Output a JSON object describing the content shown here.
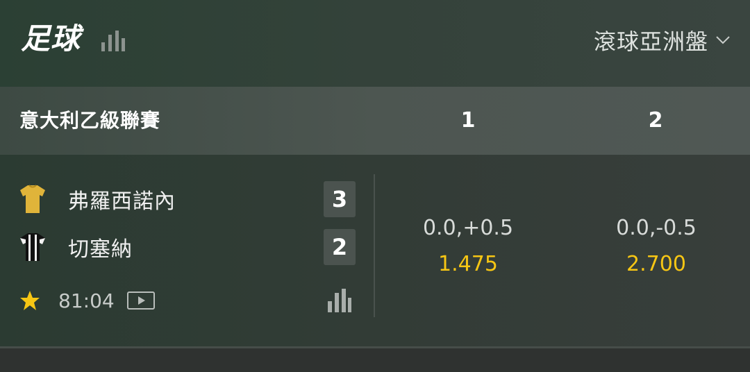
{
  "header": {
    "title": "足球",
    "stats_icon": "bar-chart-icon",
    "market_label": "滾球亞洲盤",
    "dropdown_icon": "chevron-down-icon"
  },
  "league": {
    "name": "意大利乙級聯賽",
    "col1": "1",
    "col2": "2"
  },
  "match": {
    "home": {
      "name": "弗羅西諾內",
      "score": "3",
      "shirt_icon": "yellow-jersey-icon",
      "shirt_color": "#e0b43a"
    },
    "away": {
      "name": "切塞納",
      "score": "2",
      "shirt_icon": "black-white-jersey-icon"
    },
    "favorite_icon": "star-icon",
    "clock": "81:04",
    "video_icon": "play-video-icon",
    "stats_icon": "bar-chart-icon",
    "odds": [
      {
        "handicap": "0.0,+0.5",
        "price": "1.475"
      },
      {
        "handicap": "0.0,-0.5",
        "price": "2.700"
      }
    ]
  },
  "colors": {
    "price": "#f7c614",
    "star": "#f7c614"
  }
}
